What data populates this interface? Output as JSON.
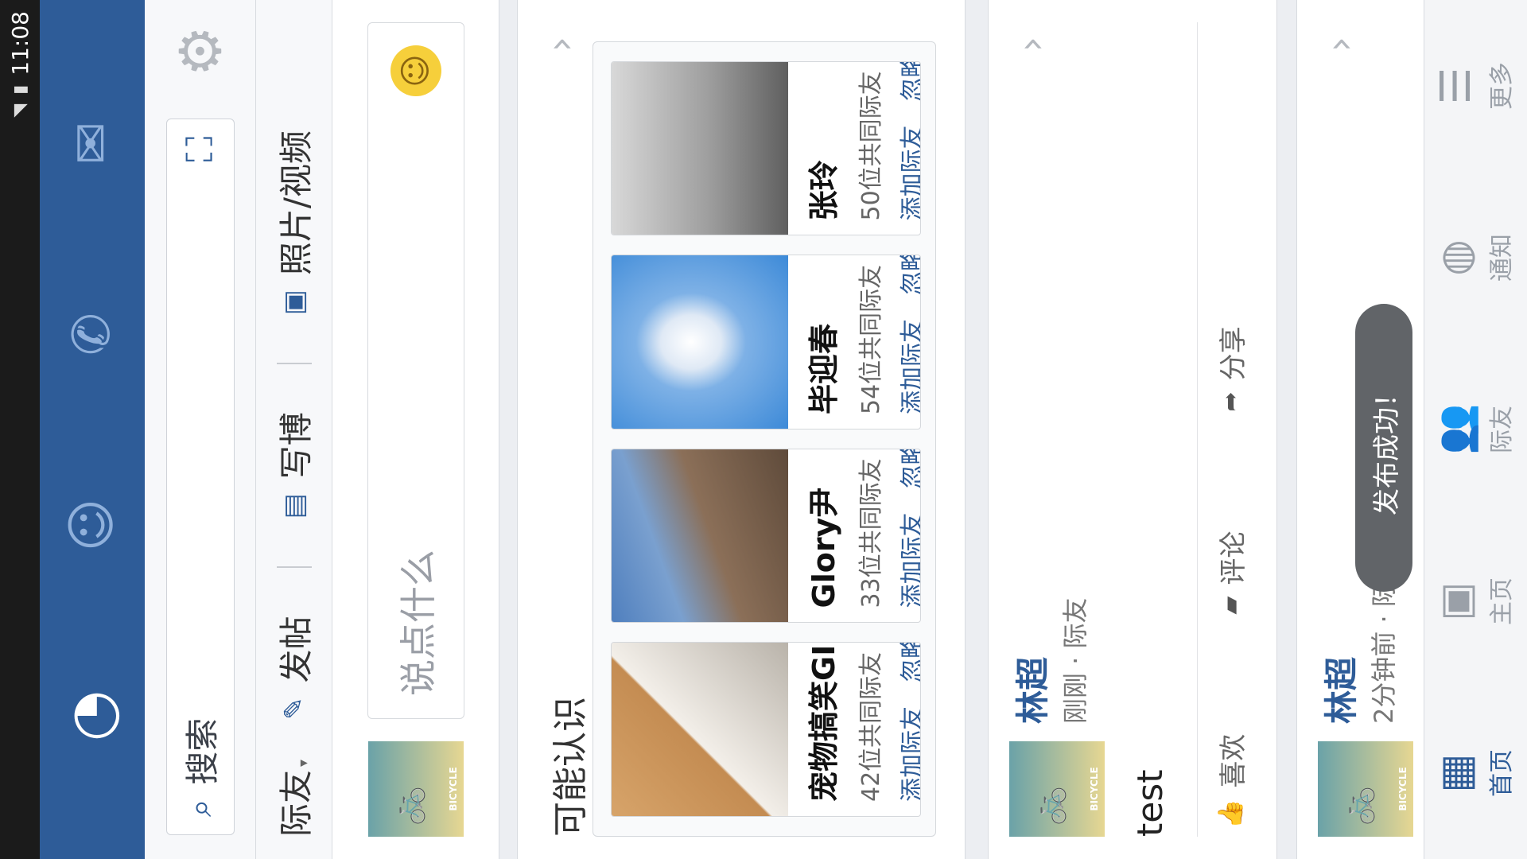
{
  "status_bar": {
    "time": "11:08"
  },
  "search": {
    "placeholder": "搜索"
  },
  "composer": {
    "circle": "际友",
    "post": "发帖",
    "blog": "写博",
    "photo": "照片/视频"
  },
  "status_box": {
    "placeholder": "说点什么"
  },
  "pymk": {
    "title": "可能认识",
    "people": [
      {
        "name": "宠物搞笑GIF",
        "mutual": "42位共同际友",
        "add": "添加际友",
        "ignore": "忽略"
      },
      {
        "name": "Glory尹",
        "mutual": "33位共同际友",
        "add": "添加际友",
        "ignore": "忽略"
      },
      {
        "name": "毕迎春",
        "mutual": "54位共同际友",
        "add": "添加际友",
        "ignore": "忽略"
      },
      {
        "name": "张玲",
        "mutual": "50位共同际友",
        "add": "添加际友",
        "ignore": "忽略"
      }
    ]
  },
  "post1": {
    "author": "林超",
    "meta": "刚刚 · 际友",
    "body": "test",
    "like": "喜欢",
    "comment": "评论",
    "share": "分享"
  },
  "post2": {
    "author": "林超",
    "meta": "2分钟前 · 际友"
  },
  "avatar_text": "BICYCLE",
  "toast": "发布成功！",
  "nav": {
    "home": "首页",
    "profile": "主页",
    "friends": "际友",
    "notify": "通知",
    "more": "更多"
  },
  "colors": {
    "brand": "#2e5c98",
    "toolbar": "#2e5c98"
  }
}
